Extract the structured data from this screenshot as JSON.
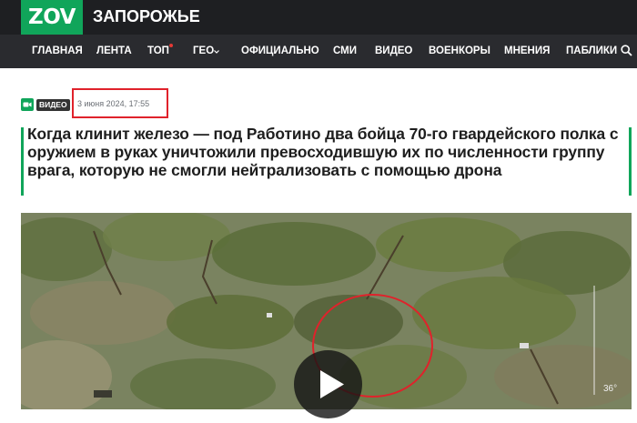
{
  "header": {
    "logo": "ZOV",
    "region": "ЗАПОРОЖЬЕ"
  },
  "nav": {
    "items": [
      {
        "label": "ГЛАВНАЯ"
      },
      {
        "label": "ЛЕНТА"
      },
      {
        "label": "ТОП",
        "has_dot": true
      },
      {
        "label": "ГЕО",
        "dropdown": true
      },
      {
        "label": "ОФИЦИАЛЬНО"
      },
      {
        "label": "СМИ"
      },
      {
        "label": "ВИДЕО"
      },
      {
        "label": "ВОЕНКОРЫ"
      },
      {
        "label": "МНЕНИЯ"
      },
      {
        "label": "ПАБЛИКИ"
      }
    ],
    "search_icon": "search-icon"
  },
  "article": {
    "badge": "ВИДЕО",
    "date": "3 июня 2024, 17:55",
    "title": "Когда клинит железо — под Работино два бойца 70-го гвардейского полка с оружием в руках уничтожили превосходившую их по численности группу врага, которую не смогли нейтрализовать с помощью дрона"
  },
  "video": {
    "play_icon": "play-icon",
    "angle_readout": "36°"
  },
  "colors": {
    "brand_green": "#10a55a",
    "highlight_red": "#e0222b",
    "nav_bg": "#2a2b2f",
    "top_bg": "#1e1f22"
  }
}
